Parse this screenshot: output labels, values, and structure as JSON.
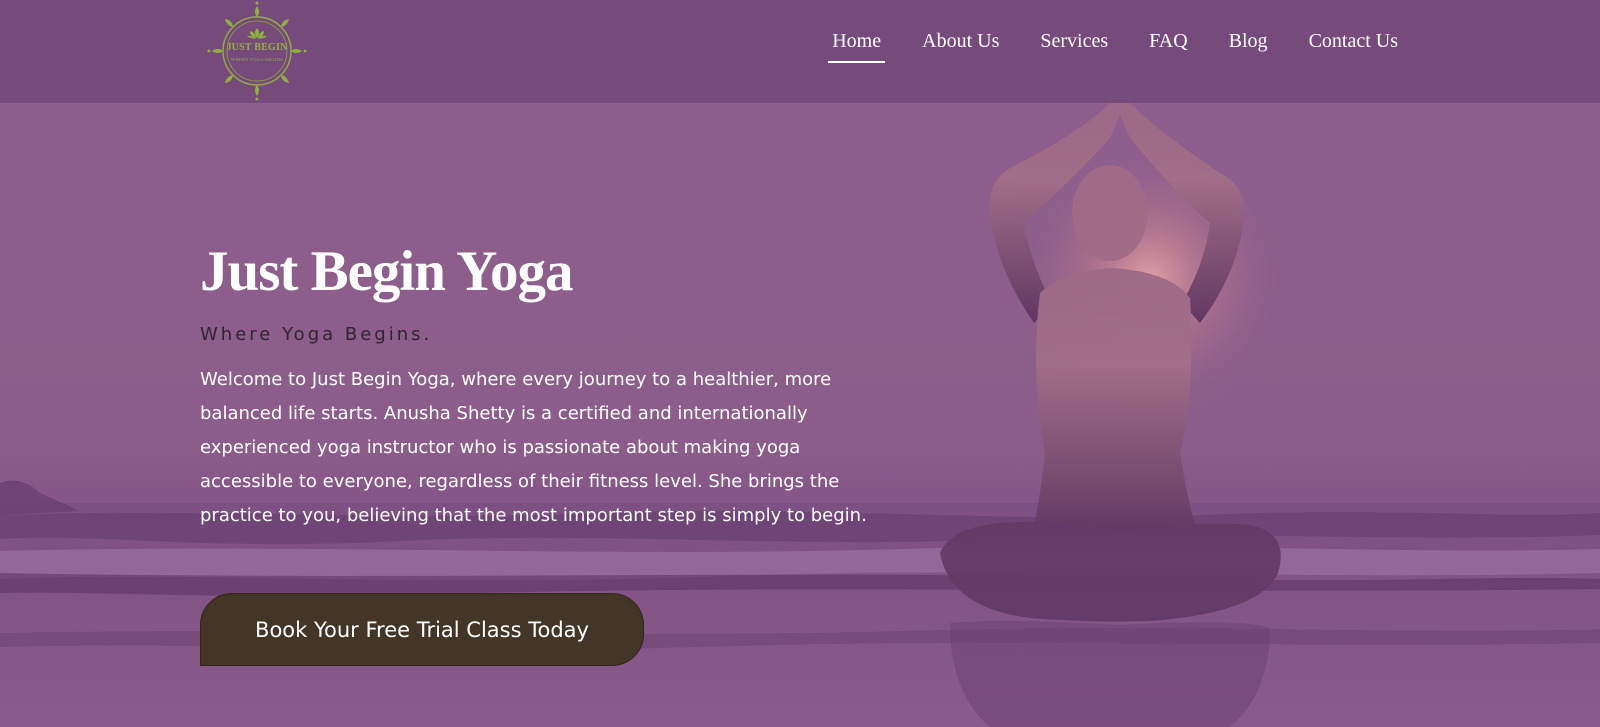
{
  "logo": {
    "title": "JUST BEGIN",
    "subtitle": "WHERE YOGA BEGINS"
  },
  "nav": {
    "items": [
      {
        "label": "Home",
        "active": true
      },
      {
        "label": "About Us"
      },
      {
        "label": "Services"
      },
      {
        "label": "FAQ"
      },
      {
        "label": "Blog"
      },
      {
        "label": "Contact Us"
      }
    ]
  },
  "hero": {
    "title": "Just Begin Yoga",
    "tagline": "Where Yoga Begins.",
    "body": "Welcome to Just Begin Yoga, where every journey to a healthier, more balanced life starts. Anusha Shetty is a certified and internationally experienced yoga instructor who is passionate about making yoga accessible to everyone, regardless of their fitness level. She brings the practice to you, believing that the most important step is simply to begin.",
    "cta_label": "Book Your Free Trial Class Today"
  },
  "colors": {
    "header_bg": "#774a7c",
    "cta_bg": "#443627",
    "logo_green": "#8fb23d"
  }
}
